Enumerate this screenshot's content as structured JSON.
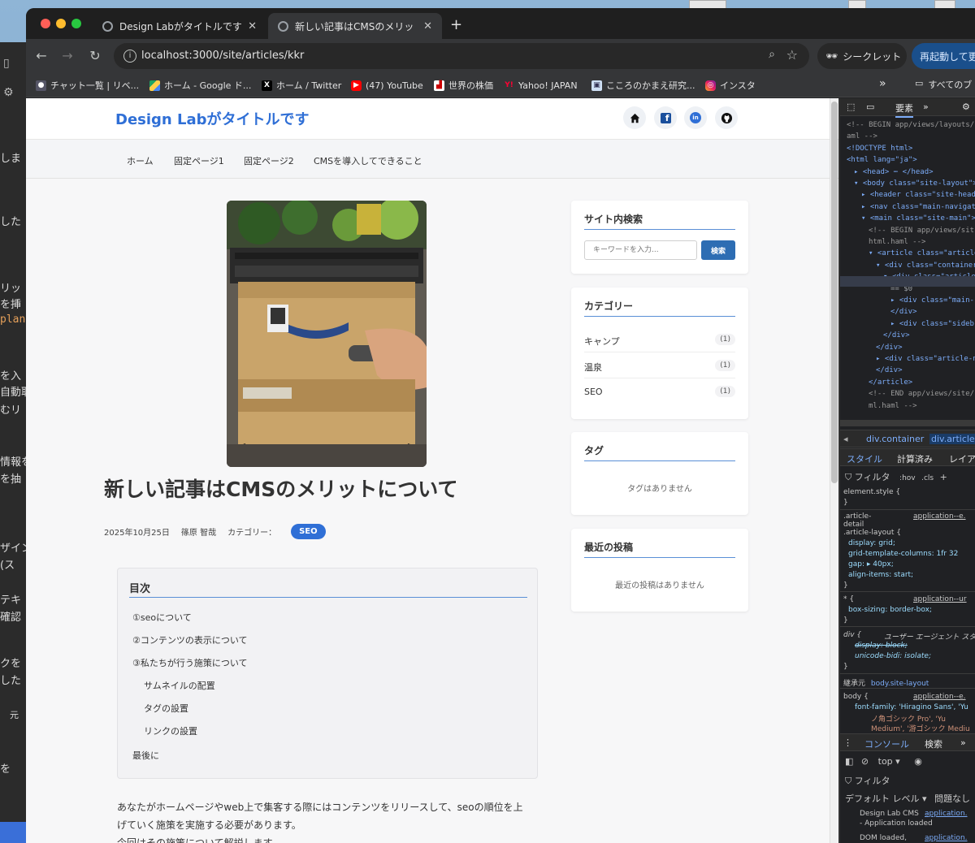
{
  "browser": {
    "tabs": [
      {
        "label": "Design Labがタイトルです",
        "active": false
      },
      {
        "label": "新しい記事はCMSのメリットについて",
        "active": true
      }
    ],
    "url": "localhost:3000/site/articles/kkr",
    "incognito_label": "シークレット",
    "restart_label": "再起動して更新",
    "bookmarks": [
      {
        "label": "チャット一覧 | リベ...",
        "icon": "person-icon"
      },
      {
        "label": "ホーム - Google ド...",
        "icon": "drive-icon"
      },
      {
        "label": "ホーム / Twitter",
        "icon": "x-icon"
      },
      {
        "label": "(47) YouTube",
        "icon": "youtube-icon"
      },
      {
        "label": "世界の株価",
        "icon": "chart-icon"
      },
      {
        "label": "Yahoo! JAPAN",
        "icon": "yahoo-icon"
      },
      {
        "label": "こころのかまえ研究...",
        "icon": "site-icon"
      },
      {
        "label": "インスタ",
        "icon": "instagram-icon"
      }
    ],
    "all_bookmarks_label": "すべてのブ"
  },
  "site": {
    "title": "Design Labがタイトルです",
    "nav": [
      "ホーム",
      "固定ページ1",
      "固定ページ2",
      "CMSを導入してできること"
    ],
    "social_icons": [
      "home-icon",
      "facebook-icon",
      "linkedin-icon",
      "github-icon"
    ],
    "social_glyphs": {
      "facebook": "f",
      "linkedin": "in"
    }
  },
  "article": {
    "title": "新しい記事はCMSのメリットについて",
    "date": "2025年10月25日",
    "author": "篠原 智哉",
    "category_label": "カテゴリー：",
    "category": "SEO",
    "toc": {
      "title": "目次",
      "items": [
        {
          "label": "①seoについて",
          "indent": false
        },
        {
          "label": "②コンテンツの表示について",
          "indent": false
        },
        {
          "label": "③私たちが行う施策について",
          "indent": false
        },
        {
          "label": "サムネイルの配置",
          "indent": true
        },
        {
          "label": "タグの設置",
          "indent": true
        },
        {
          "label": "リンクの設置",
          "indent": true
        },
        {
          "label": "最後に",
          "indent": false
        }
      ]
    },
    "body": [
      "あなたがホームページやweb上で集客する際にはコンテンツをリリースして、seoの順位を上",
      "げていく施策を実施する必要があります。",
      "今回はその施策について解説します。"
    ]
  },
  "sidebar": {
    "search": {
      "title": "サイト内検索",
      "placeholder": "キーワードを入力...",
      "button": "検索"
    },
    "categories": {
      "title": "カテゴリー",
      "items": [
        {
          "name": "キャンプ",
          "count": "(1)"
        },
        {
          "name": "温泉",
          "count": "(1)"
        },
        {
          "name": "SEO",
          "count": "(1)"
        }
      ]
    },
    "tags": {
      "title": "タグ",
      "empty": "タグはありません"
    },
    "recent": {
      "title": "最近の投稿",
      "empty": "最近の投稿はありません"
    }
  },
  "devtools": {
    "elements_tab": "要素",
    "breadcrumb": [
      "div.container",
      "div.article-"
    ],
    "style_tabs": [
      "スタイル",
      "計算済み",
      "レイア"
    ],
    "filter_label": "フィルタ",
    "hov": ":hov",
    "cls": ".cls",
    "console_tab": "コンソール",
    "search_tab": "検索",
    "console_context": "top",
    "console_filter": "フィルタ",
    "default_levels": "デフォルト レベル",
    "no_issues": "問題なし",
    "console_lines": [
      "Design Lab CMS",
      "- Application loaded",
      "DOM loaded,"
    ],
    "console_links": [
      "application.",
      "application."
    ],
    "inherited_label": "継承元",
    "inherited_from": "body.site-layout",
    "user_agent_label": "ユーザー エージェント スタ",
    "dom_lines": [
      {
        "indent": 0,
        "text": "<!-- BEGIN app/views/layouts/si"
      },
      {
        "indent": 0,
        "text": "aml -->"
      },
      {
        "indent": 0,
        "text": "<!DOCTYPE html>"
      },
      {
        "indent": 0,
        "text": "<html lang=\"ja\">"
      },
      {
        "indent": 1,
        "text": "▸ <head> ⋯ </head>"
      },
      {
        "indent": 1,
        "text": "▾ <body class=\"site-layout\">"
      },
      {
        "indent": 2,
        "text": "▸ <header class=\"site-header"
      },
      {
        "indent": 2,
        "text": "▸ <nav class=\"main-navigatio"
      },
      {
        "indent": 2,
        "text": "▾ <main class=\"site-main\">"
      },
      {
        "indent": 3,
        "text": "<!-- BEGIN app/views/sit"
      },
      {
        "indent": 3,
        "text": "html.haml -->"
      },
      {
        "indent": 3,
        "text": "▾ <article class=\"article-"
      },
      {
        "indent": 4,
        "text": "▾ <div class=\"container\""
      },
      {
        "indent": 5,
        "text": "▾ <div class=\"article-"
      },
      {
        "indent": 6,
        "text": "== $0"
      },
      {
        "indent": 6,
        "text": "▸ <div class=\"main-"
      },
      {
        "indent": 6,
        "text": "</div>"
      },
      {
        "indent": 6,
        "text": "▸ <div class=\"sideb"
      },
      {
        "indent": 5,
        "text": "</div>"
      },
      {
        "indent": 4,
        "text": "</div>"
      },
      {
        "indent": 4,
        "text": "▸ <div class=\"article-na"
      },
      {
        "indent": 4,
        "text": "</div>"
      },
      {
        "indent": 3,
        "text": "</article>"
      },
      {
        "indent": 3,
        "text": "<!-- END app/views/site/"
      },
      {
        "indent": 3,
        "text": "ml.haml -->"
      }
    ],
    "css_lines": [
      "element.style {",
      "}",
      ".article-",
      "detail",
      ".article-layout {",
      "  display: grid;",
      "  grid-template-columns: 1fr 32",
      "  gap: ▸ 40px;",
      "  align-items: start;",
      "}",
      "* {",
      "  box-sizing: border-box;",
      "}",
      "div {",
      "  display: block;",
      "  unicode-bidi: isolate;",
      "}"
    ],
    "css_sources": [
      "application--e.",
      "application--ur"
    ],
    "body_rule": [
      "body {",
      "font-family: 'Hiragino Sans', 'Yu",
      "ノ角ゴシック Pro', 'Yu",
      "Medium', '游ゴシック Mediu"
    ],
    "body_rule_source": "application--e."
  },
  "behind_window": {
    "snippets": [
      "しま",
      "した",
      "リッ",
      "を挿",
      "plan",
      "を入",
      "自動取",
      "むリ",
      "情報を",
      "を抽",
      "ザイン",
      "(ス",
      "テキ",
      "確認",
      "クを",
      "した",
      "元",
      "を"
    ]
  },
  "colors": {
    "accent": "#2f6fd6",
    "search_button": "#2d6db3"
  }
}
